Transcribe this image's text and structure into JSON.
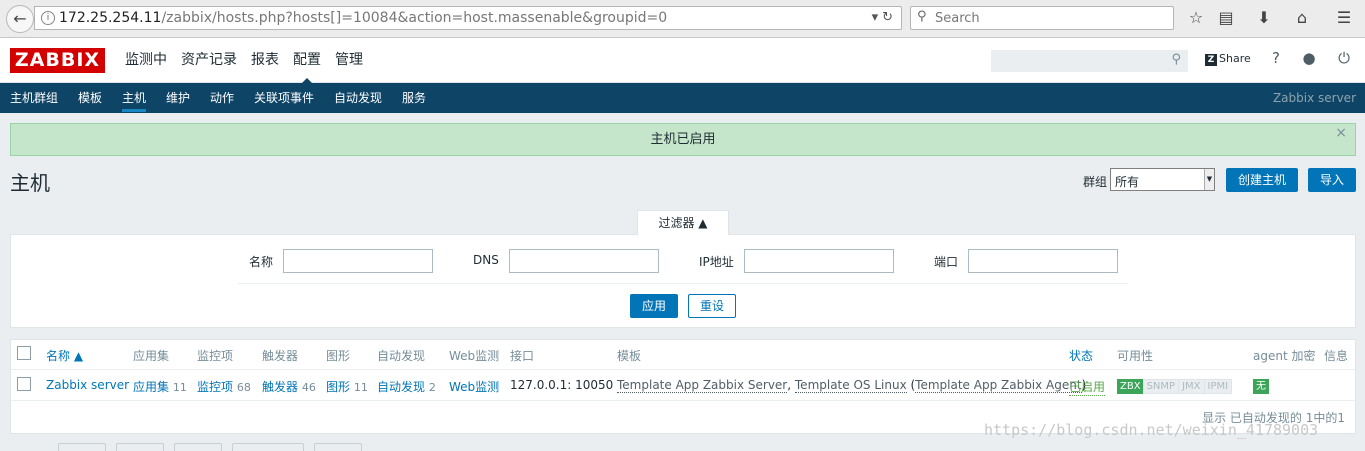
{
  "browser": {
    "url_host": "172.25.254.11",
    "url_path": "/zabbix/hosts.php?hosts[]=10084&action=host.massenable&groupid=0",
    "search_placeholder": "Search"
  },
  "header": {
    "logo": "ZABBIX",
    "menu": [
      "监测中",
      "资产记录",
      "报表",
      "配置",
      "管理"
    ],
    "active_menu": "配置",
    "share_label": "Share",
    "help_label": "?"
  },
  "submenu": {
    "items": [
      "主机群组",
      "模板",
      "主机",
      "维护",
      "动作",
      "关联项事件",
      "自动发现",
      "服务"
    ],
    "active": "主机",
    "server_name": "Zabbix server"
  },
  "message": {
    "text": "主机已启用",
    "close": "×"
  },
  "page": {
    "title": "主机",
    "group_label": "群组",
    "group_value": "所有",
    "create_button": "创建主机",
    "import_button": "导入"
  },
  "filter": {
    "tab_label": "过滤器 ▲",
    "fields": [
      {
        "label": "名称",
        "value": ""
      },
      {
        "label": "DNS",
        "value": ""
      },
      {
        "label": "IP地址",
        "value": ""
      },
      {
        "label": "端口",
        "value": ""
      }
    ],
    "apply_button": "应用",
    "reset_button": "重设"
  },
  "table": {
    "columns": [
      "名称 ▲",
      "应用集",
      "监控项",
      "触发器",
      "图形",
      "自动发现",
      "Web监测",
      "接口",
      "模板",
      "状态",
      "可用性",
      "agent 加密",
      "信息"
    ],
    "rows": [
      {
        "name": "Zabbix server",
        "applications": "应用集",
        "applications_count": "11",
        "items": "监控项",
        "items_count": "68",
        "triggers": "触发器",
        "triggers_count": "46",
        "graphs": "图形",
        "graphs_count": "11",
        "discovery": "自动发现",
        "discovery_count": "2",
        "web": "Web监测",
        "interface": "127.0.0.1: 10050",
        "template_1": "Template App Zabbix Server",
        "template_2": "Template OS Linux",
        "template_3": "Template App Zabbix Agent",
        "status": "已启用",
        "availability": [
          "ZBX",
          "SNMP",
          "JMX",
          "IPMI"
        ],
        "encryption": "无"
      }
    ],
    "footer": "显示 已自动发现的 1中的1"
  },
  "watermark": "https://blog.csdn.net/weixin_41789003"
}
